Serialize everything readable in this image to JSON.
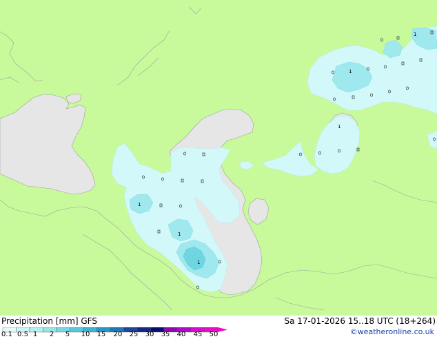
{
  "legend": {
    "title": "Precipitation [mm] GFS",
    "valid_time": "Sa 17-01-2026 15..18 UTC (18+264)",
    "credit": "©weatheronline.co.uk",
    "scale_labels": [
      "0.1",
      "0.5",
      "1",
      "2",
      "5",
      "10",
      "15",
      "20",
      "25",
      "30",
      "35",
      "40",
      "45",
      "50"
    ],
    "scale_colors": [
      "#e6fafa",
      "#c8f5f5",
      "#b2f0f0",
      "#96e6e6",
      "#78d7e6",
      "#5ac8dc",
      "#3cb4d2",
      "#2896c8",
      "#1e78be",
      "#1e46a0",
      "#14288c",
      "#0a0a78",
      "#8c0ab4",
      "#b40ac8",
      "#dc0ad2",
      "#f00ac8"
    ]
  },
  "map": {
    "land_color": "#c8fa9b",
    "sea_color": "#e6e6e6",
    "light_precip_color": "#d2f8fa",
    "medium_precip_color": "#9ee8ee",
    "heavy_precip_color": "#6dd6e0",
    "point_labels": [
      {
        "text": "1"
      },
      {
        "text": "1"
      },
      {
        "text": "1"
      },
      {
        "text": "1"
      },
      {
        "text": "1"
      },
      {
        "text": "1"
      }
    ]
  }
}
